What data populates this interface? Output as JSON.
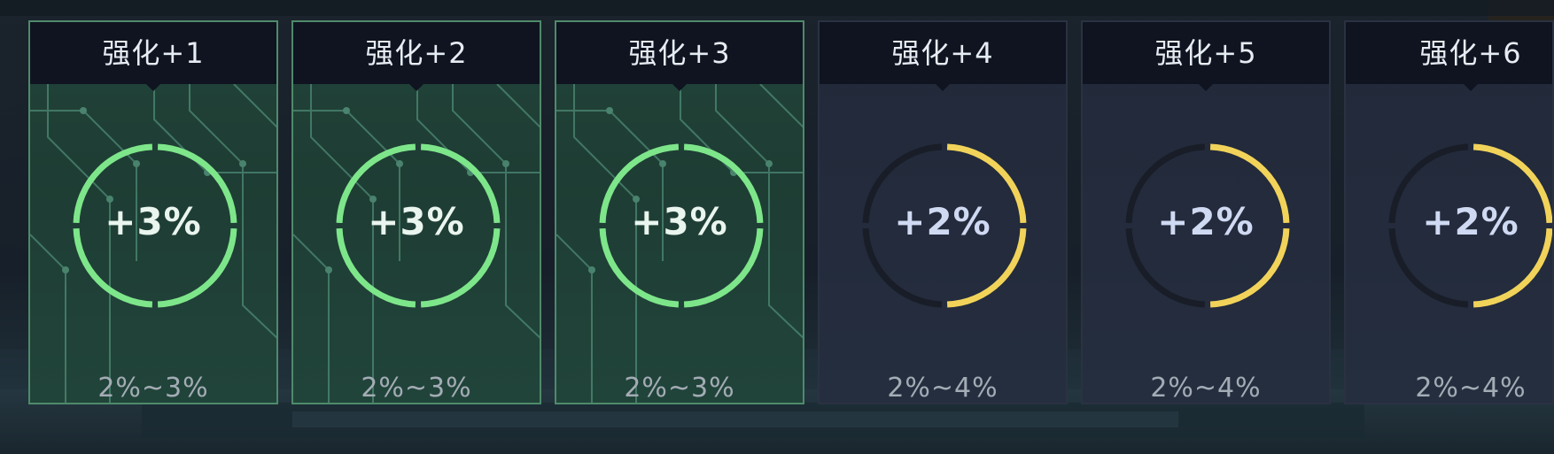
{
  "colors": {
    "active_ring": "#7ee68a",
    "inactive_ring": "#f2d35a",
    "ring_track_inactive": "#181d27",
    "active_card_bg": "#21443a",
    "inactive_card_bg": "#232b3c"
  },
  "levels": [
    {
      "title": "强化+1",
      "bonus": "+3%",
      "range": "2%~3%",
      "state": "active",
      "ring_fill_fraction": 1.0
    },
    {
      "title": "强化+2",
      "bonus": "+3%",
      "range": "2%~3%",
      "state": "active",
      "ring_fill_fraction": 1.0
    },
    {
      "title": "强化+3",
      "bonus": "+3%",
      "range": "2%~3%",
      "state": "active",
      "ring_fill_fraction": 1.0
    },
    {
      "title": "强化+4",
      "bonus": "+2%",
      "range": "2%~4%",
      "state": "inactive",
      "ring_fill_fraction": 0.5
    },
    {
      "title": "强化+5",
      "bonus": "+2%",
      "range": "2%~4%",
      "state": "inactive",
      "ring_fill_fraction": 0.5
    },
    {
      "title": "强化+6",
      "bonus": "+2%",
      "range": "2%~4%",
      "state": "inactive",
      "ring_fill_fraction": 0.5
    }
  ]
}
